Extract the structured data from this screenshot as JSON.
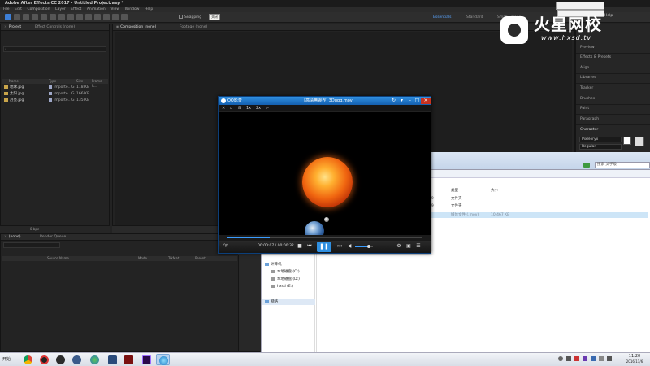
{
  "ae": {
    "title": "Adobe After Effects CC 2017 - Untitled Project.aep *",
    "menu": [
      "File",
      "Edit",
      "Composition",
      "Layer",
      "Effect",
      "Animation",
      "View",
      "Window",
      "Help"
    ],
    "snapping_label": "Snapping",
    "workspaces": [
      "Essentials",
      "Standard",
      "Small Screen"
    ],
    "help_label": "Help",
    "project_tab": "Project",
    "effect_controls_tab": "Effect Controls (none)",
    "composition_tab": "Composition (none)",
    "footage_tab": "Footage (none)",
    "search_placeholder": "",
    "project_columns": [
      "Name",
      "Type",
      "Size",
      "Frame R..."
    ],
    "project_files": [
      {
        "name": "地球.jpg",
        "type": "Importe...G",
        "size": "118 KB"
      },
      {
        "name": "太阳.jpg",
        "type": "Importe...G",
        "size": "166 KB"
      },
      {
        "name": "月亮.jpg",
        "type": "Importe...G",
        "size": "135 KB"
      }
    ],
    "bpc": "8 bpc",
    "right_panel_items": [
      "Preview",
      "Effects & Presets",
      "Align",
      "Libraries",
      "Tracker",
      "Brushes",
      "Paint",
      "Paragraph",
      "Character"
    ],
    "character_font": "Pixeloryx",
    "character_style": "Regular",
    "timeline_tab": "(none)",
    "render_queue_tab": "Render Queue",
    "timeline_columns": [
      "Source Name",
      "Mode",
      "TrkMat",
      "Parent"
    ]
  },
  "qqplayer": {
    "app_name": "QQ影音",
    "filename": "[高清無邊界] 3Dqqq.mov",
    "close_tip": "关闭",
    "tools": [
      "1x",
      "2x"
    ],
    "time": "00:00:07 / 00:00:32",
    "progress": 0.22,
    "volume": 0.75
  },
  "explorer": {
    "search_placeholder": "搜索 父子级",
    "columns": [
      "类型",
      "大小"
    ],
    "rows": [
      {
        "date": "29",
        "type": "文件夹",
        "size": ""
      },
      {
        "date": "29",
        "type": "文件夹",
        "size": ""
      },
      {
        "date": "",
        "type": "媒体文件 (.mov)",
        "size": "10,467 KB"
      }
    ],
    "nav": {
      "documents": "文档",
      "music": "音乐",
      "computer": "计算机",
      "drive_c": "本地磁盘 (C:)",
      "drive_d": "本地磁盘 (D:)",
      "drive_e": "hxsd (E:)",
      "network": "网络"
    }
  },
  "watermark": {
    "title": "火星网校",
    "url": "www.hxsd.tv"
  },
  "taskbar": {
    "start_label": "开始",
    "clock_time": "11:20",
    "clock_date": "2016/11/6"
  },
  "colors": {
    "ae_bg": "#232323",
    "accent_blue": "#2f8fe0",
    "close_red": "#c8321f",
    "taskbar": "#e3e7ee"
  }
}
